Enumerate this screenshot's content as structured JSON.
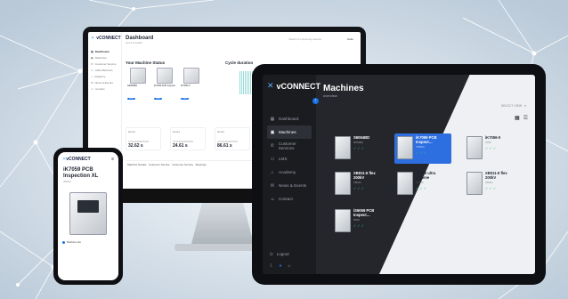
{
  "colors": {
    "accent": "#1a73e8",
    "status_green": "#37c36a",
    "dark_sidebar": "#1b1c20"
  },
  "monitor": {
    "logo": "vCONNECT",
    "title": "Dashboard",
    "subtitle": "Got a a health",
    "search": "Search & Upcoming Events",
    "user": "Hello",
    "nav": [
      "Dashboard",
      "Machines",
      "Customer Service",
      "LMS Webinars",
      "Academy",
      "News & Events",
      "Contact"
    ],
    "machine_status_title": "Your Machine Status",
    "cycle_title": "Cycle duration",
    "machines": [
      {
        "name": "S6054BD",
        "btn": "View"
      },
      {
        "name": "iK7059 PCB Inspection XL",
        "btn": "View"
      },
      {
        "name": "iK7056-0",
        "btn": "View"
      }
    ],
    "stats": [
      {
        "title": "Hours",
        "key": "CYCLE DURATION",
        "value": "32.62 s"
      },
      {
        "title": "Hours",
        "key": "CYCLE DURATION",
        "value": "24.61 s"
      },
      {
        "title": "Hours",
        "key": "CYCLE DURATION",
        "value": "86.61 s"
      }
    ],
    "footer": [
      "Machine Details",
      "Customer Service",
      "Customer Service",
      "Meetings"
    ]
  },
  "tablet": {
    "logo": "vCONNECT",
    "title": "Machines",
    "subtitle": "overview",
    "select_label": "SELECT VIEW",
    "nav": [
      {
        "label": "Dashboard",
        "icon": "dashboard-icon",
        "glyph": "▦"
      },
      {
        "label": "Machines",
        "icon": "machines-icon",
        "glyph": "▣"
      },
      {
        "label": "Customer Services",
        "icon": "customer-service-icon",
        "glyph": "✆"
      },
      {
        "label": "LMS",
        "icon": "lms-icon",
        "glyph": "▭"
      },
      {
        "label": "Academy",
        "icon": "academy-icon",
        "glyph": "⌂"
      },
      {
        "label": "News & Events",
        "icon": "news-icon",
        "glyph": "✉"
      },
      {
        "label": "Contact",
        "icon": "contact-icon",
        "glyph": "☺"
      }
    ],
    "logout": "Logout",
    "cards": [
      {
        "name": "S6054BD",
        "sn": "6054BD",
        "status": "✓✓✓"
      },
      {
        "name": "iK7059 PCB Inspect…",
        "sn": "7059XL",
        "status": "✓✓✓"
      },
      {
        "name": "iK7056-0",
        "sn": "7056",
        "status": "✓✓✓"
      },
      {
        "name": "XB011-II flex 200kV",
        "sn": "XB011",
        "status": "✓✓✓"
      },
      {
        "name": "S3059 ultra chrome",
        "sn": "S3059",
        "status": "✓✓✓"
      },
      {
        "name": "XB011-II flex 200kV",
        "sn": "XB011",
        "status": "✓✓✓"
      },
      {
        "name": "iS6059 PCB Inspect…",
        "sn": "6059",
        "status": "✓✓✓"
      }
    ]
  },
  "phone": {
    "logo": "vCONNECT",
    "title": "iK7059 PCB Inspection XL",
    "sn": "IDRSV",
    "side_label": "Machine Info"
  }
}
